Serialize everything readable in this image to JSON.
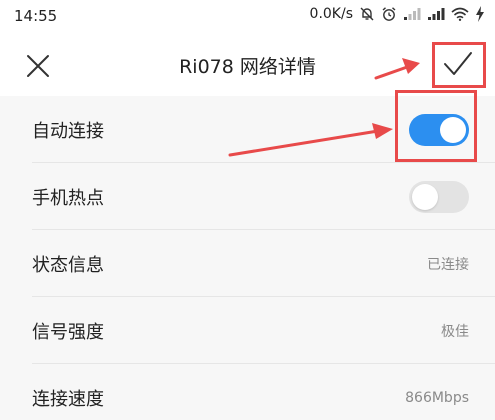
{
  "status_bar": {
    "time": "14:55",
    "speed": "0.0K/s",
    "icons": [
      "muted-bell-icon",
      "alarm-icon",
      "signal-icon",
      "signal-icon",
      "wifi-icon",
      "charging-icon"
    ]
  },
  "nav": {
    "close_icon": "close-icon",
    "title": "Ri078  网络详情",
    "confirm_icon": "check-icon"
  },
  "settings": [
    {
      "label": "自动连接",
      "control": "toggle",
      "enabled": true
    },
    {
      "label": "手机热点",
      "control": "toggle",
      "enabled": false
    },
    {
      "label": "状态信息",
      "control": "value",
      "value": "已连接"
    },
    {
      "label": "信号强度",
      "control": "value",
      "value": "极佳"
    },
    {
      "label": "连接速度",
      "control": "value",
      "value": "866Mbps"
    }
  ],
  "colors": {
    "toggle_on": "#2c8ff0",
    "toggle_off": "#e3e3e3",
    "annotation": "#e84a4a",
    "content_bg": "#f7f7f7"
  }
}
